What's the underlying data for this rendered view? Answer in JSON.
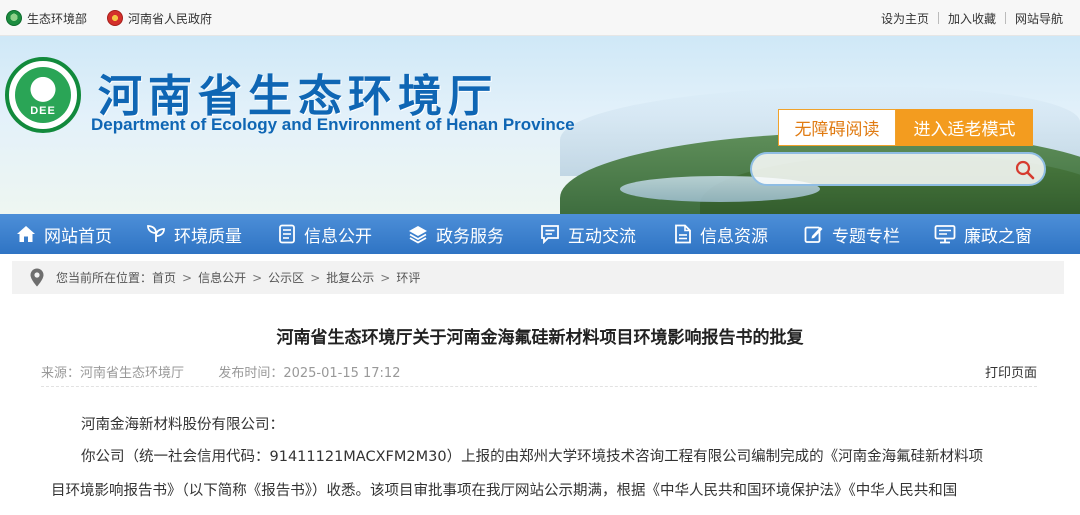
{
  "topbar": {
    "left_sites": [
      {
        "label": "生态环境部",
        "icon": "ministry-emblem-icon"
      },
      {
        "label": "河南省人民政府",
        "icon": "national-emblem-icon"
      }
    ],
    "right_links": [
      "设为主页",
      "加入收藏",
      "网站导航"
    ]
  },
  "header": {
    "title_cn": "河南省生态环境厅",
    "title_en": "Department of Ecology and Environment of Henan Province",
    "logo_text": "DEE",
    "accessibility_label": "无障碍阅读",
    "elder_mode_label": "进入适老模式",
    "search_placeholder": ""
  },
  "nav": {
    "items": [
      {
        "label": "网站首页",
        "icon": "home-icon"
      },
      {
        "label": "环境质量",
        "icon": "leaf-icon"
      },
      {
        "label": "信息公开",
        "icon": "document-icon"
      },
      {
        "label": "政务服务",
        "icon": "layers-icon"
      },
      {
        "label": "互动交流",
        "icon": "chat-icon"
      },
      {
        "label": "信息资源",
        "icon": "file-icon"
      },
      {
        "label": "专题专栏",
        "icon": "edit-icon"
      },
      {
        "label": "廉政之窗",
        "icon": "monitor-icon"
      }
    ]
  },
  "breadcrumb": {
    "prefix": "您当前所在位置：",
    "items": [
      "首页",
      "信息公开",
      "公示区",
      "批复公示",
      "环评"
    ],
    "separator": ">"
  },
  "article": {
    "title": "河南省生态环境厅关于河南金海氟硅新材料项目环境影响报告书的批复",
    "source_label": "来源：",
    "source": "河南省生态环境厅",
    "date_label": "发布时间：",
    "date": "2025-01-15 17:12",
    "print_label": "打印页面",
    "paragraphs": [
      "河南金海新材料股份有限公司：",
      "你公司（统一社会信用代码：91411121MACXFM2M30）上报的由郑州大学环境技术咨询工程有限公司编制完成的《河南金海氟硅新材料项",
      "目环境影响报告书》（以下简称《报告书》）收悉。该项目审批事项在我厅网站公示期满，根据《中华人民共和国环境保护法》《中华人民共和国"
    ]
  },
  "colors": {
    "nav_bg": "#2f74c4",
    "title_blue": "#0f66b4",
    "elder_orange": "#f39c1f",
    "access_orange": "#e07b12",
    "logo_green": "#128a3c"
  }
}
